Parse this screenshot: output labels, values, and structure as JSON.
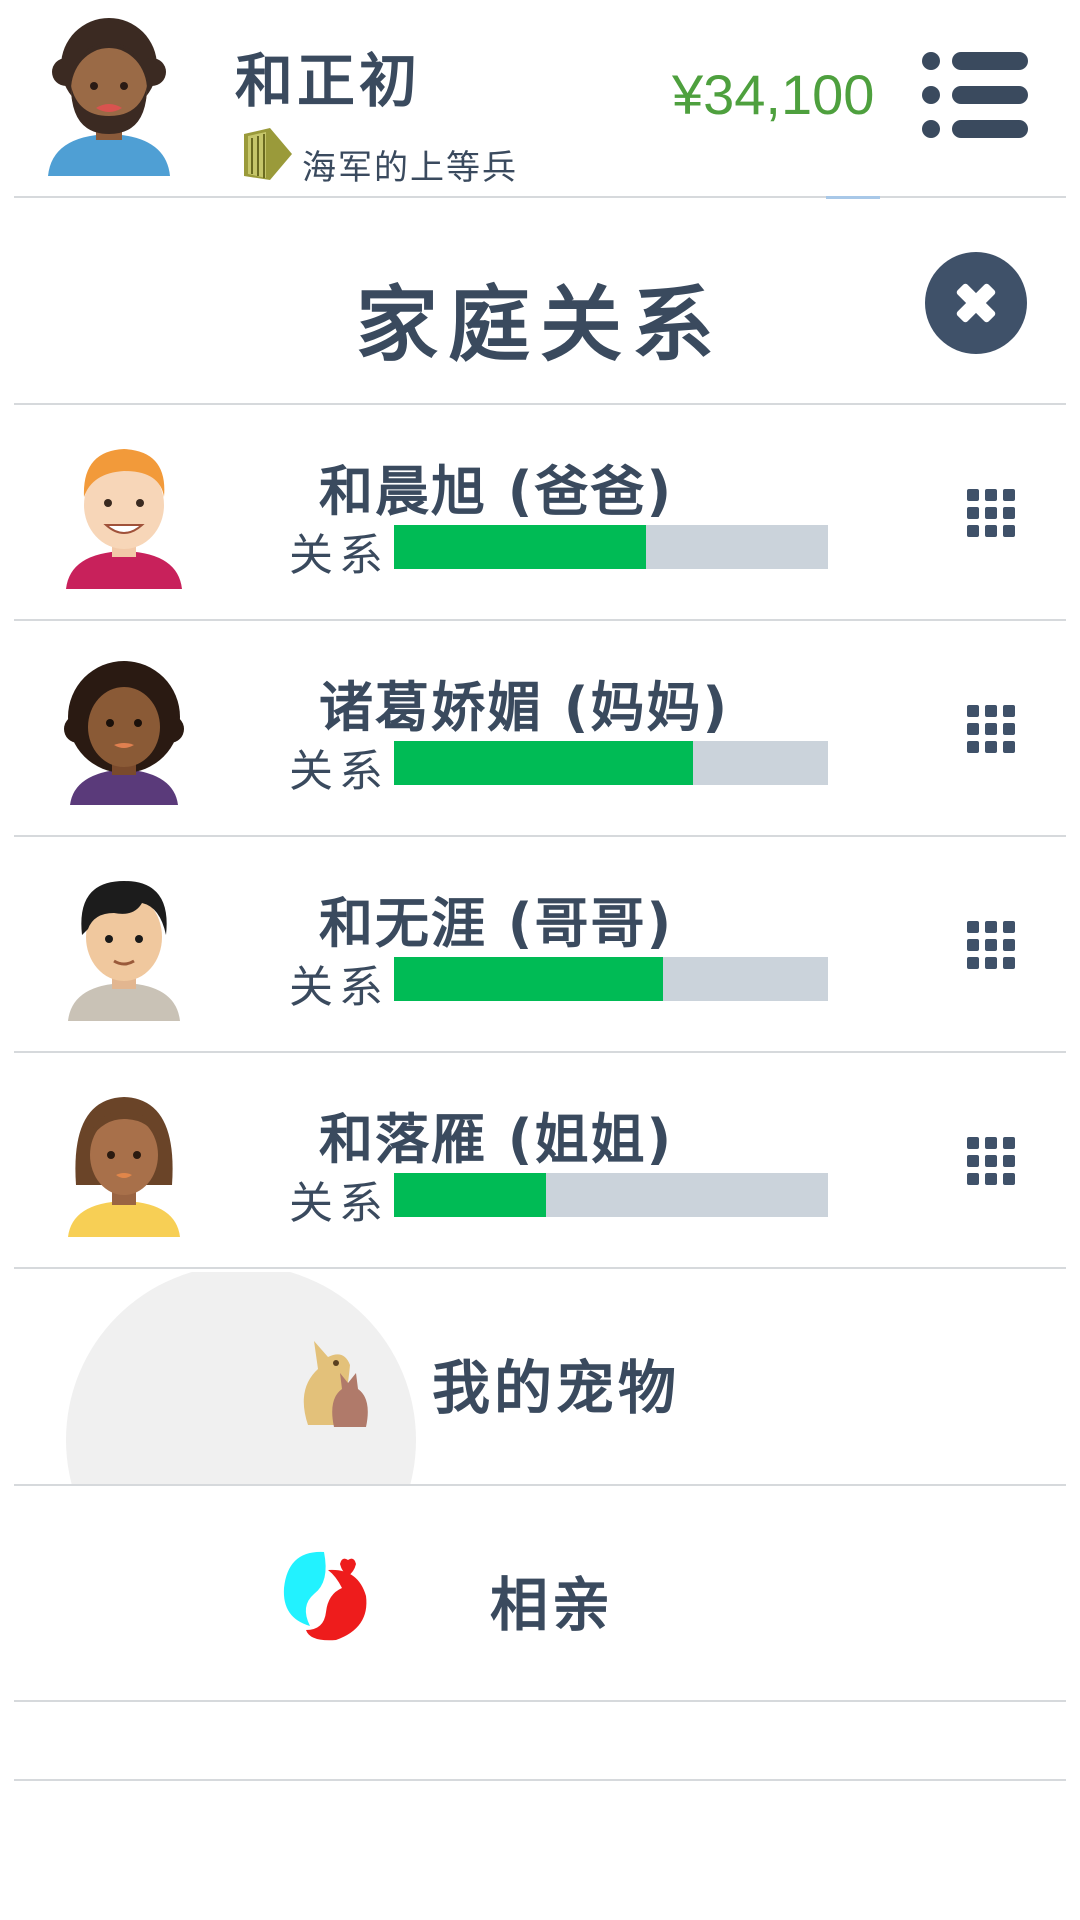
{
  "header": {
    "player_name": "和正初",
    "rank": "海军的上等兵",
    "money": "¥34,100",
    "avatar_icon": "bearded-man-avatar",
    "rank_icon": "bamboo-rank-icon",
    "menu_icon": "list-menu-icon"
  },
  "dialog": {
    "title": "家庭关系",
    "close_icon": "close-icon"
  },
  "family": [
    {
      "name": "和晨旭 (爸爸)",
      "relation_label": "关系",
      "relation_level": 0.58,
      "avatar": "redhead-man-avatar"
    },
    {
      "name": "诸葛娇媚 (妈妈)",
      "relation_label": "关系",
      "relation_level": 0.69,
      "avatar": "curly-hair-woman-avatar"
    },
    {
      "name": "和无涯 (哥哥)",
      "relation_label": "关系",
      "relation_level": 0.62,
      "avatar": "black-hair-boy-avatar"
    },
    {
      "name": "和落雁 (姐姐)",
      "relation_label": "关系",
      "relation_level": 0.35,
      "avatar": "bob-hair-girl-avatar"
    }
  ],
  "options": {
    "pets_label": "我的宠物",
    "pets_icon": "dog-and-cat-icon",
    "dating_label": "相亲",
    "dating_icon": "hearts-couple-icon"
  },
  "colors": {
    "text": "#3a4a5e",
    "money": "#4ea03e",
    "bar_fill": "#00bb55",
    "bar_track": "#cbd3db",
    "close_button": "#3f5169"
  }
}
